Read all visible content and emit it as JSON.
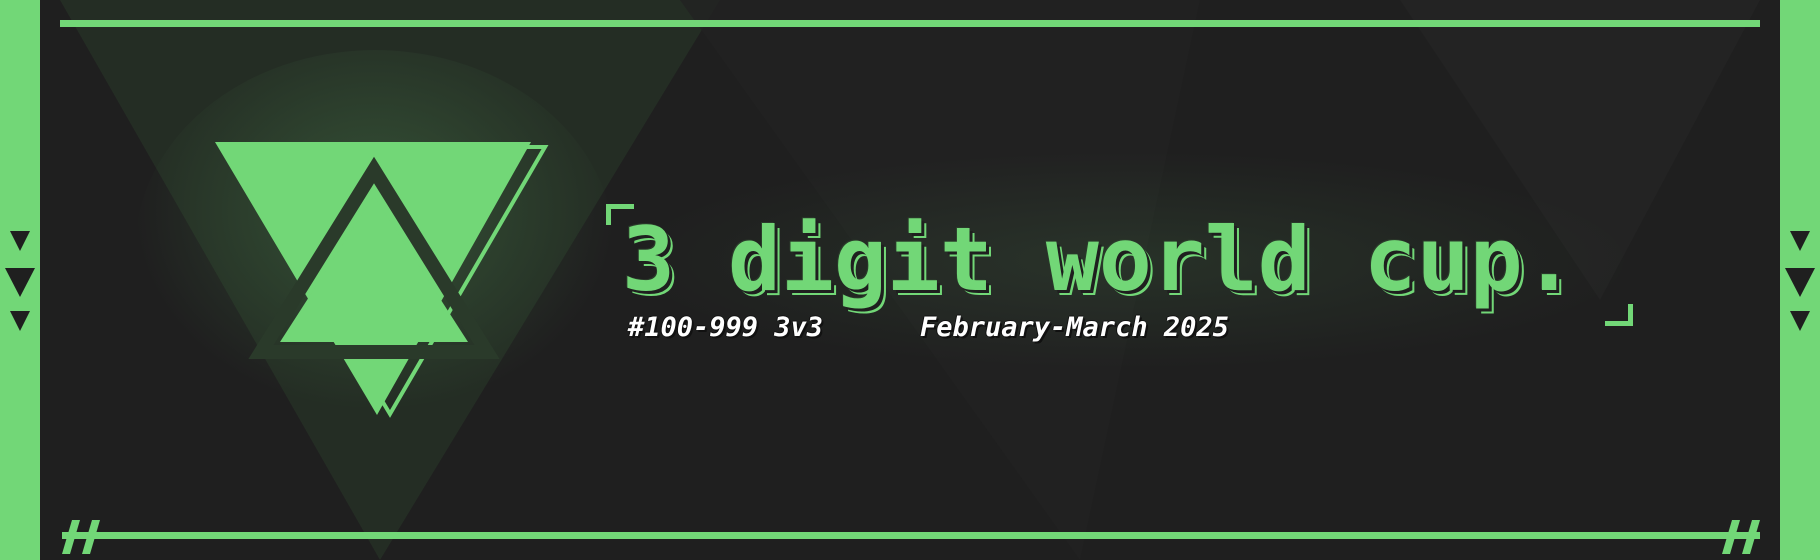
{
  "banner": {
    "title": "3 digit world cup.",
    "rank_range": "#100-999 3v3",
    "dates": "February-March 2025"
  },
  "colors": {
    "accent": "#72d777",
    "background": "#1f1f1f",
    "text": "#ffffff"
  },
  "icons": [
    "triangle-logo-icon",
    "triangle-marker-icon",
    "hash-icon",
    "corner-bracket-icon"
  ]
}
